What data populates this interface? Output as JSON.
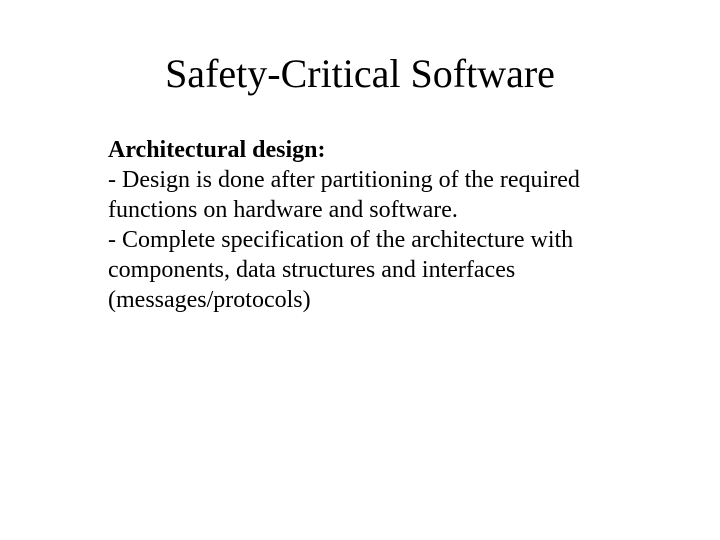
{
  "slide": {
    "title": "Safety-Critical Software",
    "subheading": "Architectural design:",
    "bullet1": "- Design is done after partitioning of the required functions on hardware and software.",
    "bullet2": "- Complete specification of the architecture with components, data structures and interfaces (messages/protocols)"
  }
}
